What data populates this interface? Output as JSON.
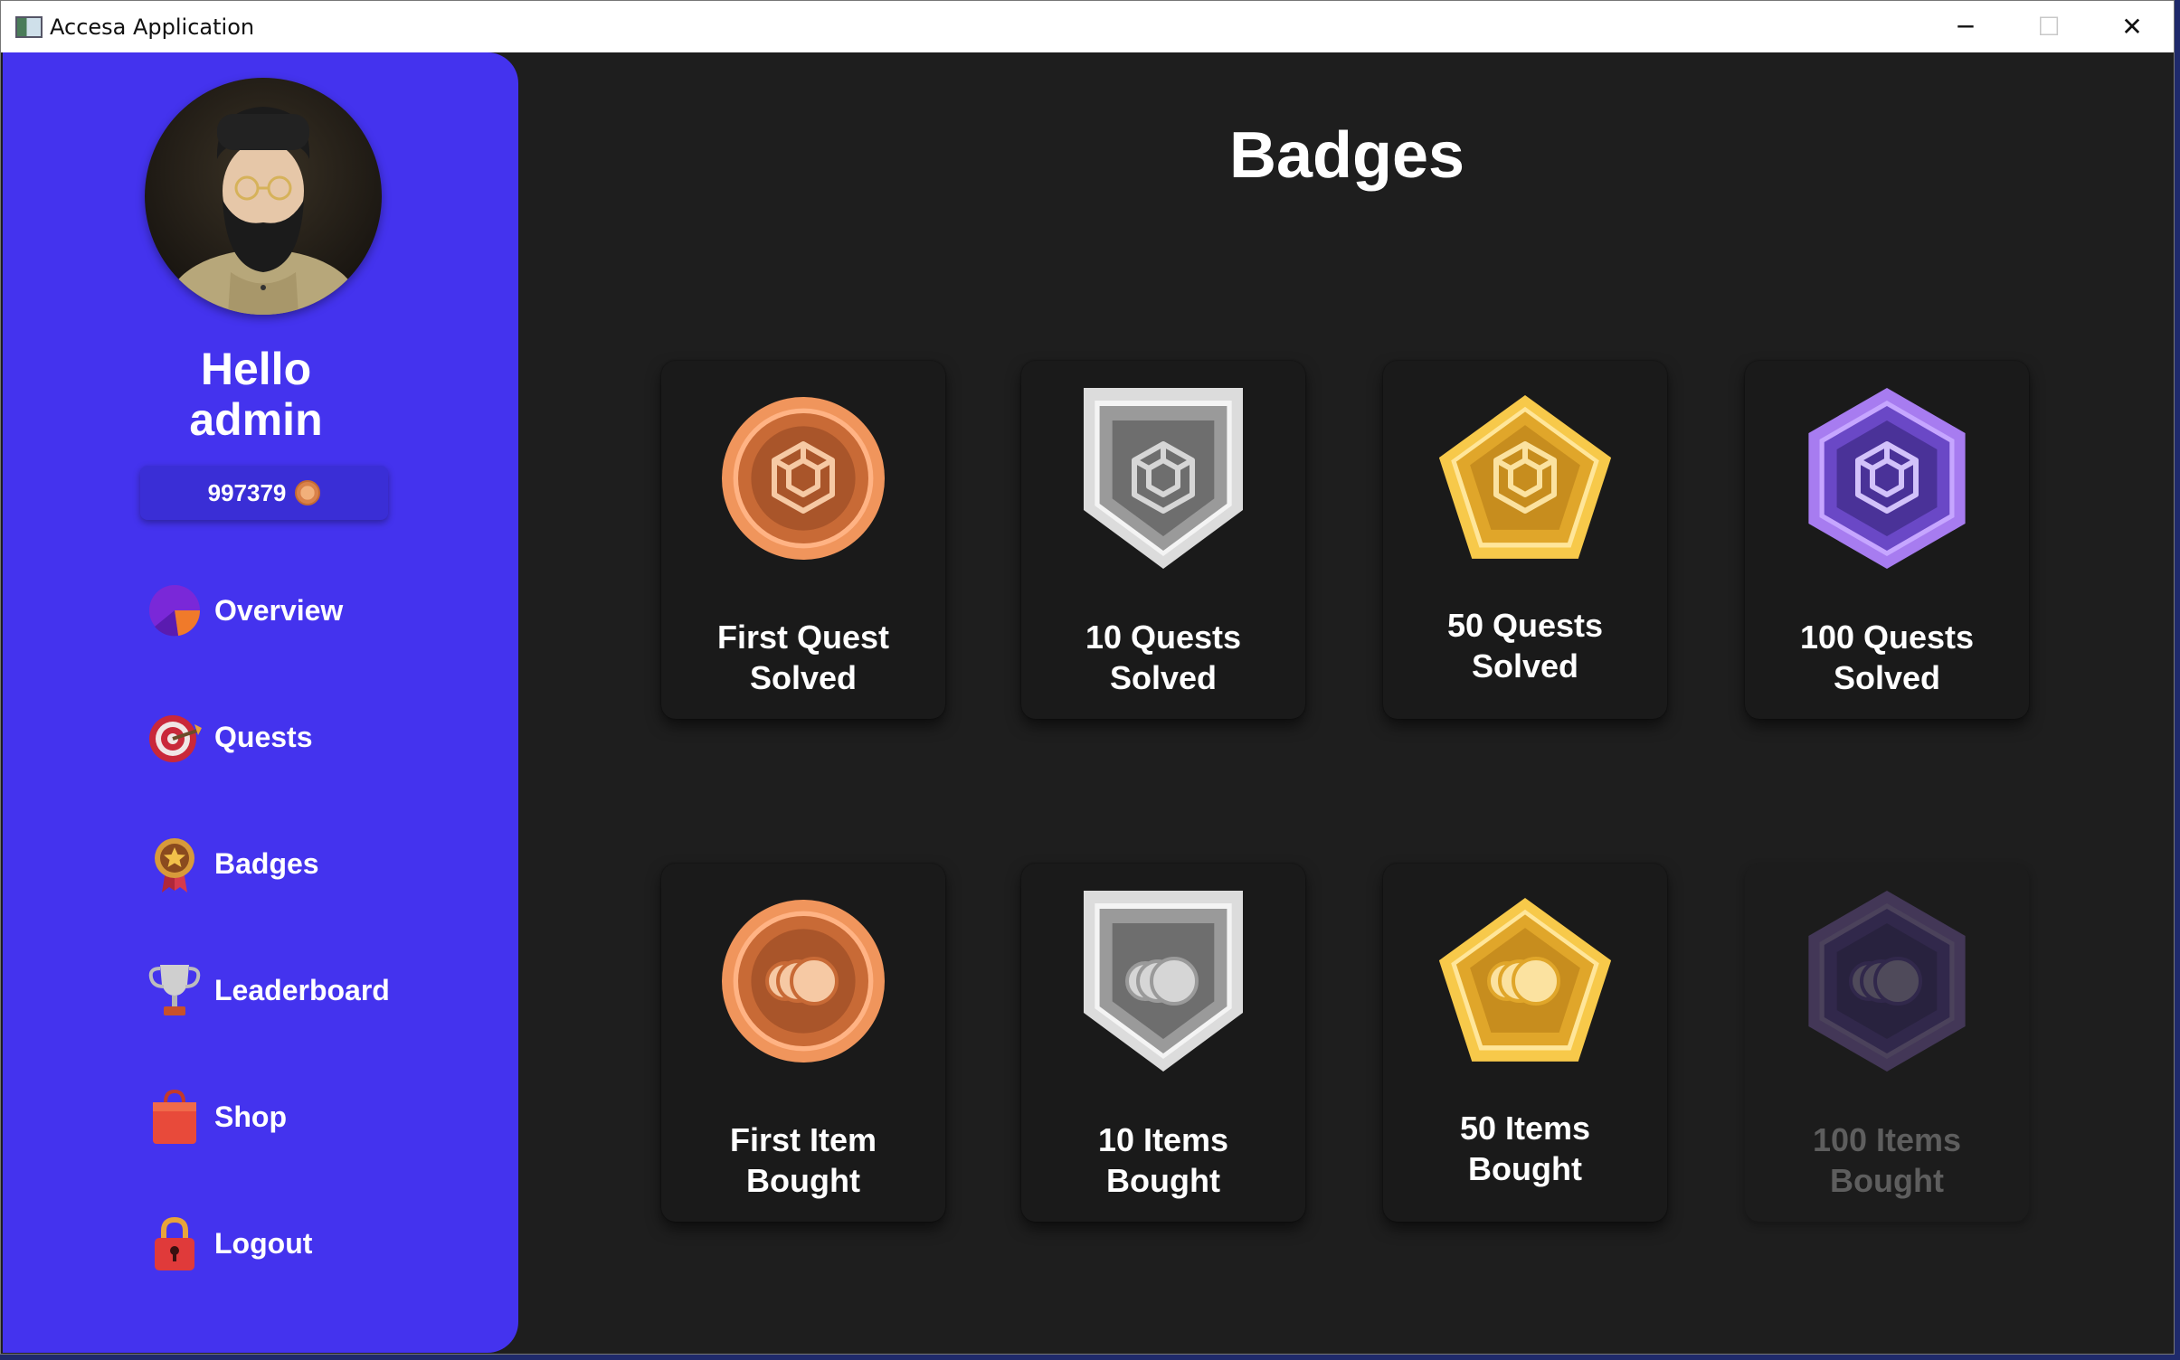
{
  "window": {
    "title": "Accesa Application",
    "minimize": "─",
    "maximize": "☐",
    "close": "✕"
  },
  "sidebar": {
    "greeting": "Hello",
    "username": "admin",
    "coins": "997379",
    "items": [
      {
        "label": "Overview",
        "icon": "pie-chart-icon"
      },
      {
        "label": "Quests",
        "icon": "target-icon"
      },
      {
        "label": "Badges",
        "icon": "medal-icon"
      },
      {
        "label": "Leaderboard",
        "icon": "trophy-icon"
      },
      {
        "label": "Shop",
        "icon": "shopping-bag-icon"
      },
      {
        "label": "Logout",
        "icon": "padlock-icon"
      }
    ]
  },
  "main": {
    "title": "Badges",
    "badges": [
      {
        "line1": "First Quest",
        "line2": "Solved",
        "tier": "bronze",
        "symbol": "cube",
        "locked": false
      },
      {
        "line1": "10 Quests",
        "line2": "Solved",
        "tier": "silver",
        "symbol": "cube",
        "locked": false
      },
      {
        "line1": "50 Quests",
        "line2": "Solved",
        "tier": "gold",
        "symbol": "cube",
        "locked": false
      },
      {
        "line1": "100 Quests",
        "line2": "Solved",
        "tier": "purple",
        "symbol": "cube",
        "locked": false
      },
      {
        "line1": "First Item",
        "line2": "Bought",
        "tier": "bronze",
        "symbol": "coins",
        "locked": false
      },
      {
        "line1": "10 Items",
        "line2": "Bought",
        "tier": "silver",
        "symbol": "coins",
        "locked": false
      },
      {
        "line1": "50 Items",
        "line2": "Bought",
        "tier": "gold",
        "symbol": "coins",
        "locked": false
      },
      {
        "line1": "100 Items",
        "line2": "Bought",
        "tier": "purple",
        "symbol": "coins",
        "locked": true
      }
    ]
  },
  "colors": {
    "sidebar": "#4433ee",
    "background": "#1e1e1e",
    "bronze": "#e07a45",
    "silver": "#bdbdbd",
    "gold": "#f2b93a",
    "purple": "#9b6ae6"
  }
}
